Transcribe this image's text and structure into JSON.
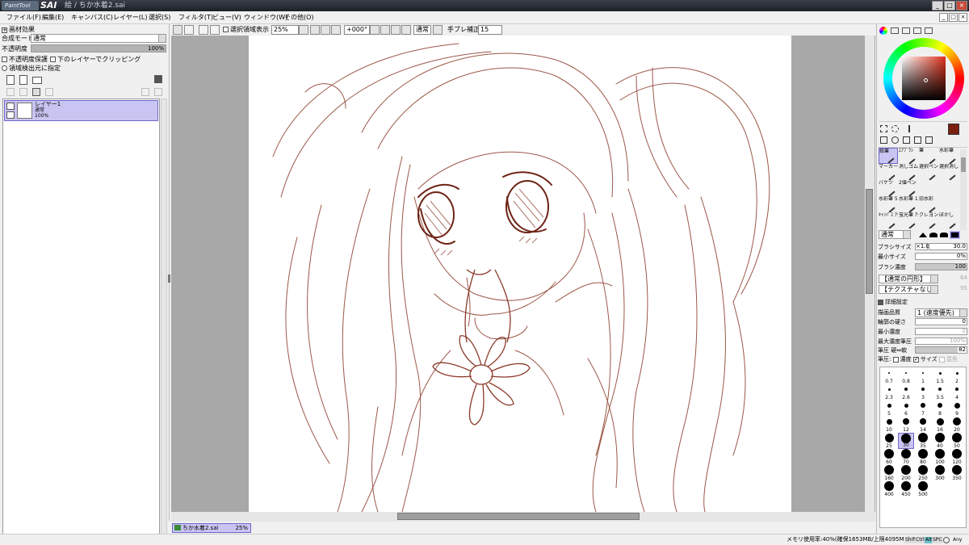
{
  "window": {
    "app_logo": "PaintTool",
    "app_name": "SAI",
    "doc_title": "絵 / ちか水着2.sai",
    "min": "_",
    "max": "□",
    "close": "×"
  },
  "menu": [
    "ファイル(F)",
    "編集(E)",
    "キャンバス(C)",
    "レイヤー(L)",
    "選択(S)",
    "フィルタ(T)",
    "ビュー(V)",
    "ウィンドウ(W)",
    "その他(O)"
  ],
  "left": {
    "texture_header": "画材効果",
    "blend_label": "合成モード",
    "blend_value": "通常",
    "opacity_label": "不透明度",
    "opacity_value": "100%",
    "opacity_fraction": 1.0,
    "preserve_opacity": "不透明度保護",
    "clip_lower": "下のレイヤーでクリッピング",
    "selection_source": "領域検出元に指定",
    "layer": {
      "name": "レイヤー1",
      "mode": "通常",
      "opacity": "100%"
    }
  },
  "toolbar": {
    "show_selection": "選択領域表示",
    "zoom": "25%",
    "rotation": "+000°",
    "blend": "通常",
    "stabilizer_label": "手ブレ補正",
    "stabilizer_value": "15"
  },
  "doc_tab": {
    "name": "ちか水着2.sai",
    "zoom": "25%"
  },
  "status": {
    "memory": "メモリ使用率:40%(確保1653MB/上限4095MB)",
    "keys": [
      "Shift",
      "Ctrl",
      "Alt",
      "SPC"
    ],
    "any": "Any"
  },
  "colors": {
    "accent_sel": "#c9c5f2",
    "sketch": "#8a3a2a",
    "main_color": "#7a1e10"
  },
  "right": {
    "tools": [
      {
        "label": "鉛筆",
        "sel": true
      },
      {
        "label": "ｴｱﾌﾞﾗｼ"
      },
      {
        "label": "筆"
      },
      {
        "label": "水彩筆"
      },
      {
        "label": "マーカー"
      },
      {
        "label": "消しゴム"
      },
      {
        "label": "選択ペン"
      },
      {
        "label": "選択消し"
      },
      {
        "label": "バケツ"
      },
      {
        "label": "2値ペン"
      },
      {
        "label": ""
      },
      {
        "label": ""
      },
      {
        "label": "水彩筆 5鋭"
      },
      {
        "label": "水彩筆 10鋭"
      },
      {
        "label": "旧水彩"
      },
      {
        "label": ""
      },
      {
        "label": "ｷｬﾝﾊﾞｽ ｱｸﾘﾙ"
      },
      {
        "label": "蛍光筆 ｱｸﾘﾙ"
      },
      {
        "label": "クレヨン"
      },
      {
        "label": "ぼかし"
      }
    ],
    "mode": "通常",
    "brush_size_label": "ブラシサイズ",
    "brush_size_mult": "×1.0",
    "brush_size": "30.0",
    "min_size_label": "最小サイズ",
    "min_size": "0%",
    "density_label": "ブラシ濃度",
    "density": "100",
    "shape": "【通常の円形】",
    "shape_val": "64",
    "texture": "【テクスチャなし】",
    "texture_val": "95",
    "detail_header": "詳細設定",
    "quality_label": "描画品質",
    "quality_value": "1 (速度優先)",
    "edge_label": "輪郭の硬さ",
    "edge_value": "0",
    "min_density_label": "最小濃度",
    "min_density_value": "0",
    "max_pressure_label": "最大濃度筆圧",
    "max_pressure_value": "100%",
    "pressure_label": "筆圧 硬⇔軟",
    "pressure_value": "82",
    "pressure2_label": "筆圧:",
    "density_chk": "濃度",
    "size_chk": "サイズ",
    "blend_chk": "混色",
    "sizes": [
      "0.7",
      "0.8",
      "1",
      "1.5",
      "2",
      "2.3",
      "2.6",
      "3",
      "3.5",
      "4",
      "5",
      "6",
      "7",
      "8",
      "9",
      "10",
      "12",
      "14",
      "16",
      "20",
      "25",
      "30",
      "35",
      "40",
      "50",
      "60",
      "70",
      "80",
      "100",
      "120",
      "160",
      "200",
      "250",
      "300",
      "350",
      "400",
      "450",
      "500"
    ],
    "selected_size": "30"
  }
}
